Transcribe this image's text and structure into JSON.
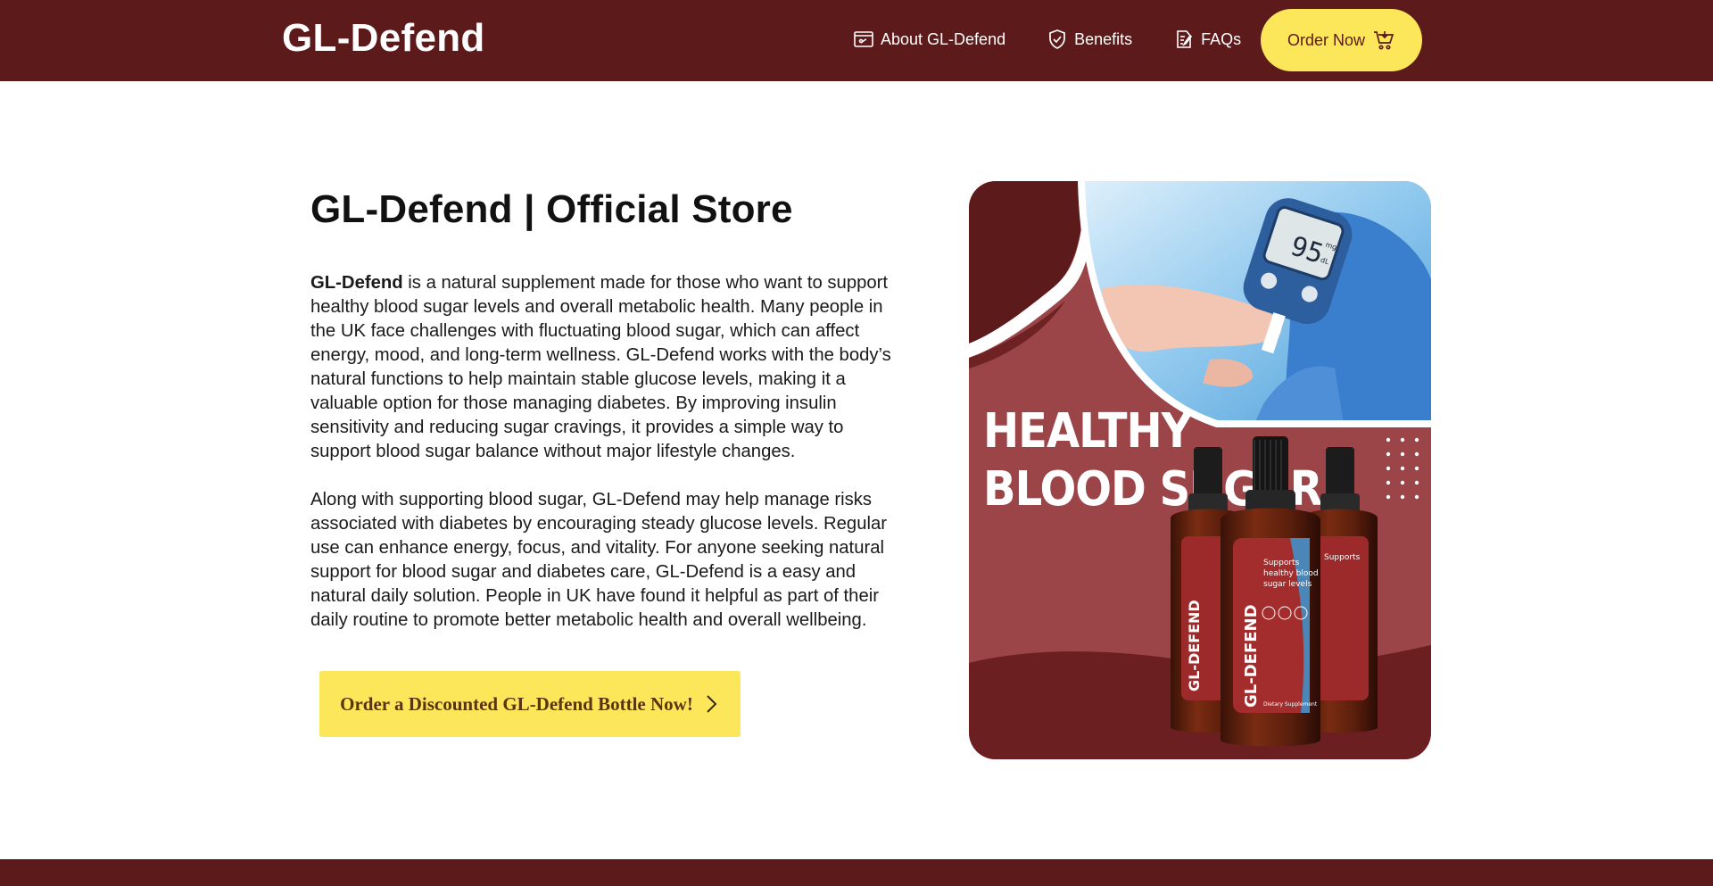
{
  "header": {
    "brand": "GL-Defend",
    "nav": [
      {
        "label": "About GL-Defend",
        "icon": "card-icon"
      },
      {
        "label": "Benefits",
        "icon": "shield-check-icon"
      },
      {
        "label": "FAQs",
        "icon": "document-edit-icon"
      }
    ],
    "order_button": {
      "label": "Order Now",
      "icon": "cart-icon"
    }
  },
  "main": {
    "title": "GL-Defend | Official Store",
    "paragraph1_bold": "GL-Defend",
    "paragraph1_rest": " is a natural supplement made for those who want to support healthy blood sugar levels and overall metabolic health. Many people in the UK face challenges with fluctuating blood sugar, which can affect energy, mood, and long-term wellness. GL-Defend works with the body’s natural functions to help maintain stable glucose levels, making it a valuable option for those managing diabetes. By improving insulin sensitivity and reducing sugar cravings, it provides a simple way to support blood sugar balance without major lifestyle changes.",
    "paragraph2": "Along with supporting blood sugar, GL-Defend may help manage risks associated with diabetes by encouraging steady glucose levels. Regular use can enhance energy, focus, and vitality. For anyone seeking natural support for blood sugar and diabetes care, GL-Defend is a easy and natural daily solution. People in UK have found it helpful as part of their daily routine to promote better metabolic health and overall wellbeing.",
    "cta": {
      "label": "Order a Discounted GL-Defend Bottle Now!",
      "icon": "chevron-right-icon"
    }
  },
  "hero_image": {
    "headline_line1": "HEALTHY",
    "headline_line2": "BLOOD SUGAR",
    "meter_reading": "95",
    "meter_unit_top": "mg",
    "meter_unit_bottom": "dL",
    "bottle_brand": "GL-DEFEND",
    "bottle_claim_line1": "Supports",
    "bottle_claim_line2": "healthy blood",
    "bottle_claim_line3": "sugar levels",
    "bottle_footer": "Dietary Supplement"
  },
  "colors": {
    "brand_dark": "#5c1a1b",
    "accent_yellow": "#fce65a",
    "hero_red": "#9c4548"
  }
}
